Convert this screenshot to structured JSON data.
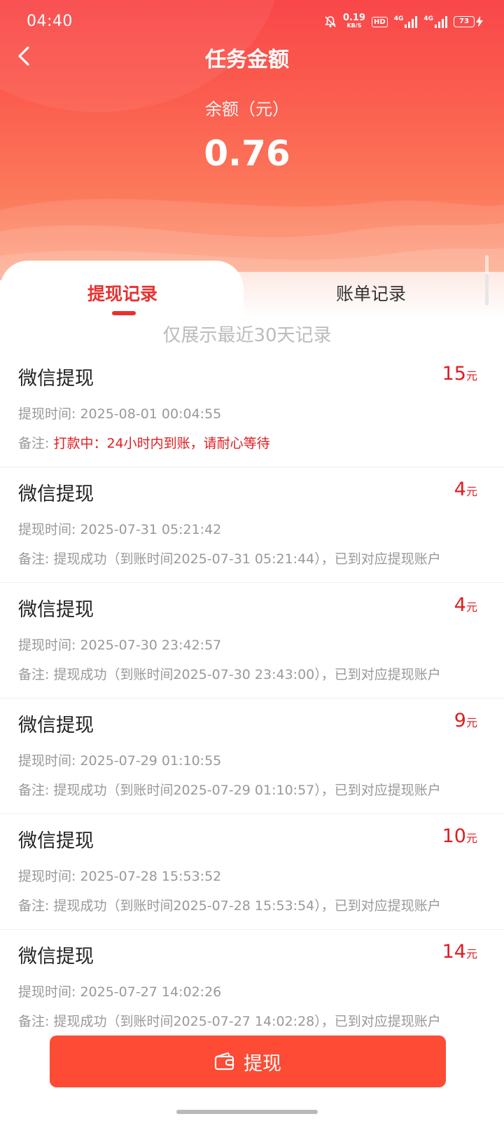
{
  "status_bar": {
    "time": "04:40",
    "speed_value": "0.19",
    "speed_unit": "KB/S",
    "hd": "HD",
    "net1": "4G",
    "net2": "4G",
    "battery": "73"
  },
  "header": {
    "title": "任务金额",
    "balance_label": "余额（元）",
    "balance_value": "0.76"
  },
  "tabs": [
    {
      "label": "提现记录",
      "active": true
    },
    {
      "label": "账单记录",
      "active": false
    }
  ],
  "notice": "仅展示最近30天记录",
  "records": [
    {
      "title": "微信提现",
      "amount": "15",
      "unit": "元",
      "time_label": "提现时间: ",
      "time": "2025-08-01 00:04:55",
      "note_label": "备注: ",
      "note": "打款中：24小时内到账，请耐心等待",
      "pending": true
    },
    {
      "title": "微信提现",
      "amount": "4",
      "unit": "元",
      "time_label": "提现时间: ",
      "time": "2025-07-31 05:21:42",
      "note_label": "备注: ",
      "note": "提现成功（到账时间2025-07-31 05:21:44），已到对应提现账户",
      "pending": false
    },
    {
      "title": "微信提现",
      "amount": "4",
      "unit": "元",
      "time_label": "提现时间: ",
      "time": "2025-07-30 23:42:57",
      "note_label": "备注: ",
      "note": "提现成功（到账时间2025-07-30 23:43:00），已到对应提现账户",
      "pending": false
    },
    {
      "title": "微信提现",
      "amount": "9",
      "unit": "元",
      "time_label": "提现时间: ",
      "time": "2025-07-29 01:10:55",
      "note_label": "备注: ",
      "note": "提现成功（到账时间2025-07-29 01:10:57），已到对应提现账户",
      "pending": false
    },
    {
      "title": "微信提现",
      "amount": "10",
      "unit": "元",
      "time_label": "提现时间: ",
      "time": "2025-07-28 15:53:52",
      "note_label": "备注: ",
      "note": "提现成功（到账时间2025-07-28 15:53:54），已到对应提现账户",
      "pending": false
    },
    {
      "title": "微信提现",
      "amount": "14",
      "unit": "元",
      "time_label": "提现时间: ",
      "time": "2025-07-27 14:02:26",
      "note_label": "备注: ",
      "note": "提现成功（到账时间2025-07-27 14:02:28），已到对应提现账户",
      "pending": false
    }
  ],
  "withdraw_button": {
    "label": "提现",
    "icon": "wallet-icon"
  },
  "colors": {
    "accent": "#e8312f",
    "amount": "#e01c20",
    "button": "#fd4b35",
    "header_top": "#f9474a",
    "header_bottom": "#fd9a76"
  }
}
